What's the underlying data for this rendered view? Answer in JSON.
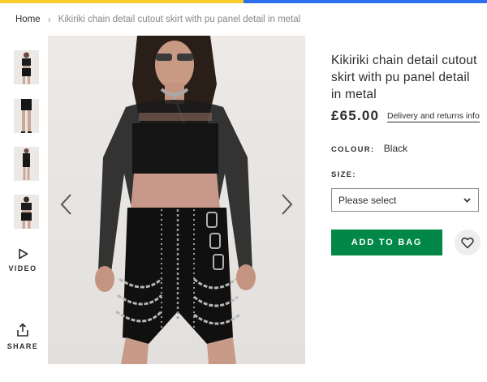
{
  "colors": {
    "accent_yellow": "#fccc2f",
    "accent_blue": "#2f6fef",
    "add_button": "#018849"
  },
  "breadcrumb": {
    "home": "Home",
    "separator": "›",
    "current": "Kikiriki chain detail cutout skirt with pu panel detail in metal"
  },
  "gallery": {
    "thumbnails": [
      {
        "icon": "product-thumbnail-front"
      },
      {
        "icon": "product-thumbnail-legs"
      },
      {
        "icon": "product-thumbnail-full"
      },
      {
        "icon": "product-thumbnail-back"
      }
    ],
    "video_label": "VIDEO",
    "share_label": "SHARE",
    "main_image_icon": "product-photo"
  },
  "product": {
    "title": "Kikiriki chain detail cutout skirt with pu panel detail in metal",
    "price": "£65.00",
    "delivery_link": "Delivery and returns info",
    "colour_label": "COLOUR:",
    "colour_value": "Black",
    "size_label": "SIZE:",
    "size_select_value": "Please select",
    "add_to_bag": "ADD TO BAG"
  }
}
